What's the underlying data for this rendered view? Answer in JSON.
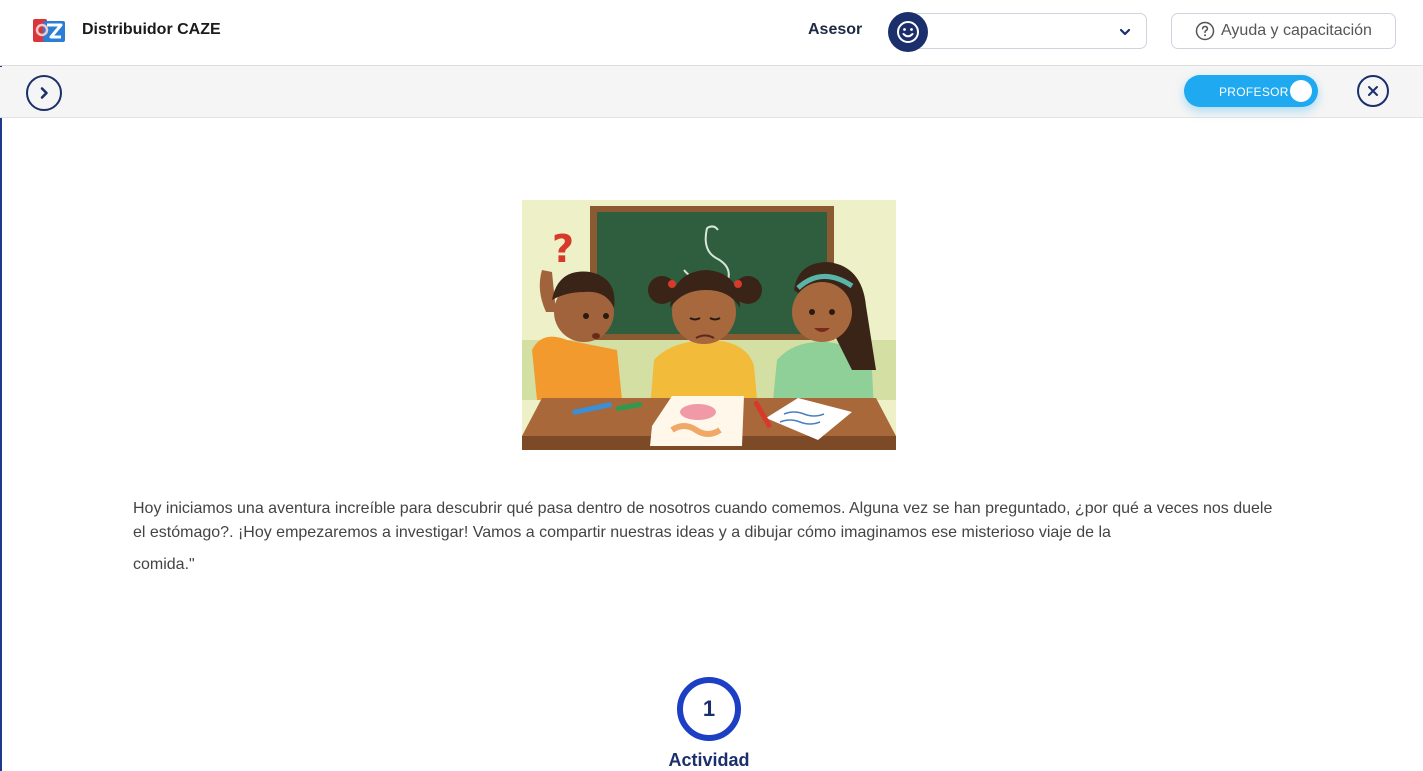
{
  "header": {
    "brand": "Distribuidor CAZE",
    "advisor_label": "Asesor",
    "advisor_select_value": "",
    "help_label": "Ayuda y capacitación"
  },
  "toolbar": {
    "role_toggle_label": "PROFESOR",
    "role_toggle_on": true
  },
  "content": {
    "paragraph_lines": [
      "Hoy iniciamos una aventura increíble para descubrir qué pasa dentro de nosotros cuando comemos. Alguna vez se han preguntado, ¿por qué a veces nos duele",
      "el estómago?. ¡Hoy empezaremos a investigar! Vamos a compartir nuestras ideas y a dibujar cómo imaginamos ese misterioso viaje de la"
    ],
    "paragraph_last": "comida.\"",
    "activity_number": "1",
    "activity_label": "Actividad"
  },
  "colors": {
    "primary_navy": "#1a2f6b",
    "toggle_blue": "#1fa9f0",
    "step_ring": "#1d3fc4"
  },
  "icons": [
    "caze-logo",
    "smiley-icon",
    "chevron-down-icon",
    "help-circle-icon",
    "chevron-right-icon",
    "close-icon"
  ]
}
